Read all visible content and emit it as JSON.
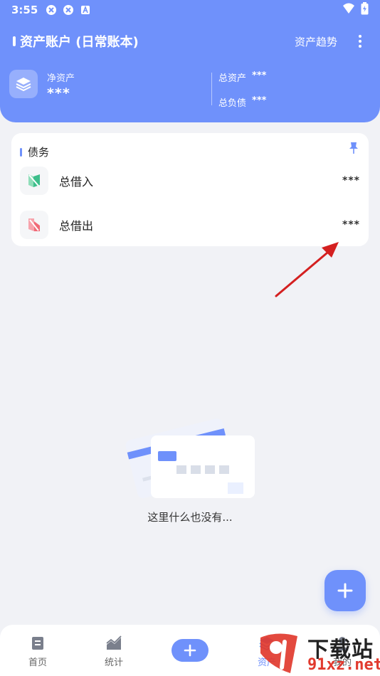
{
  "status_bar": {
    "time": "3:55",
    "icons": [
      "app-notification-icon",
      "app-notification-icon",
      "a-badge-icon"
    ],
    "right_icons": [
      "wifi-icon",
      "battery-icon"
    ]
  },
  "header": {
    "title": "资产账户 (日常账本)",
    "trend_label": "资产趋势",
    "net_assets_label": "净资产",
    "net_assets_value": "***",
    "total_assets_label": "总资产",
    "total_assets_value": "***",
    "total_liabilities_label": "总负债",
    "total_liabilities_value": "***"
  },
  "debt_card": {
    "title": "债务",
    "items": [
      {
        "label": "总借入",
        "value": "***",
        "icon": "borrow-in-icon",
        "color": "#3DBE8B"
      },
      {
        "label": "总借出",
        "value": "***",
        "icon": "lend-out-icon",
        "color": "#F06A77"
      }
    ]
  },
  "empty_state": {
    "text": "这里什么也没有..."
  },
  "bottom_nav": {
    "items": [
      {
        "label": "首页",
        "icon": "home-icon"
      },
      {
        "label": "统计",
        "icon": "chart-icon"
      },
      {
        "label": "资产",
        "icon": "assets-icon"
      },
      {
        "label": "我的",
        "icon": "profile-icon"
      }
    ]
  },
  "colors": {
    "accent": "#6F91FB",
    "background": "#F1F2F6",
    "annotation_arrow": "#D42020"
  },
  "watermark": {
    "title": "下载站",
    "domain": "91xz.net"
  }
}
